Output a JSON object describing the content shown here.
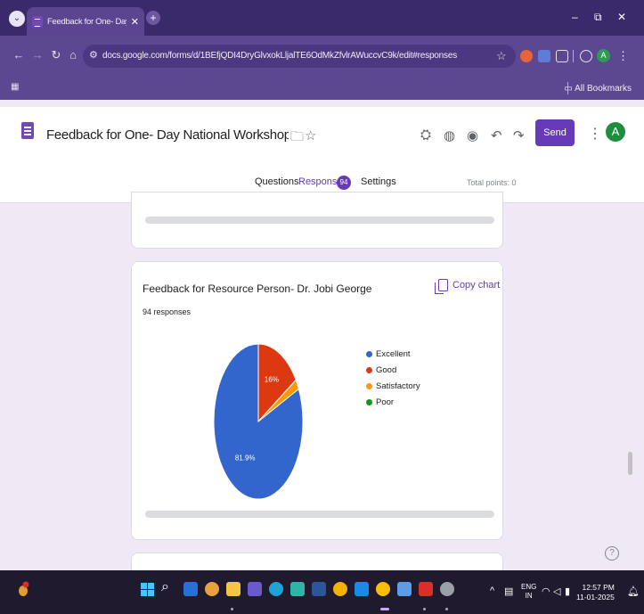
{
  "browser": {
    "tab_title": "Feedback for One- Day Nation",
    "url": "docs.google.com/forms/d/1BEfjQDI4DryGlvxokLljalTE6OdMkZfvlrAWuccvC9k/edit#responses",
    "all_bookmarks": "All Bookmarks"
  },
  "header": {
    "form_title": "Feedback for  One- Day National Workshop on Strengthening",
    "send_label": "Send",
    "avatar_letter": "A"
  },
  "tabs": {
    "questions": "Questions",
    "responses": "Responses",
    "responses_count": "94",
    "settings": "Settings",
    "total_points": "Total points: 0"
  },
  "question": {
    "title": "Feedback for Resource Person- Dr. Jobi George",
    "responses": "94 responses",
    "copy_chart": "Copy chart"
  },
  "chart_data": {
    "type": "pie",
    "categories": [
      "Excellent",
      "Good",
      "Satisfactory",
      "Poor"
    ],
    "values": [
      81.9,
      16,
      2.1,
      0
    ],
    "labels": [
      "81.9%",
      "16%",
      "",
      ""
    ],
    "colors": [
      "#3366cc",
      "#dc3912",
      "#ff9900",
      "#109618"
    ],
    "legend_position": "right"
  },
  "help": "?",
  "taskbar": {
    "lang_top": "ENG",
    "lang_bottom": "IN",
    "time": "12:57 PM",
    "date": "11-01-2025"
  },
  "colors": {
    "accent": "#673ab7",
    "chrome": "#5c4791",
    "page_bg": "#efe9f6"
  }
}
